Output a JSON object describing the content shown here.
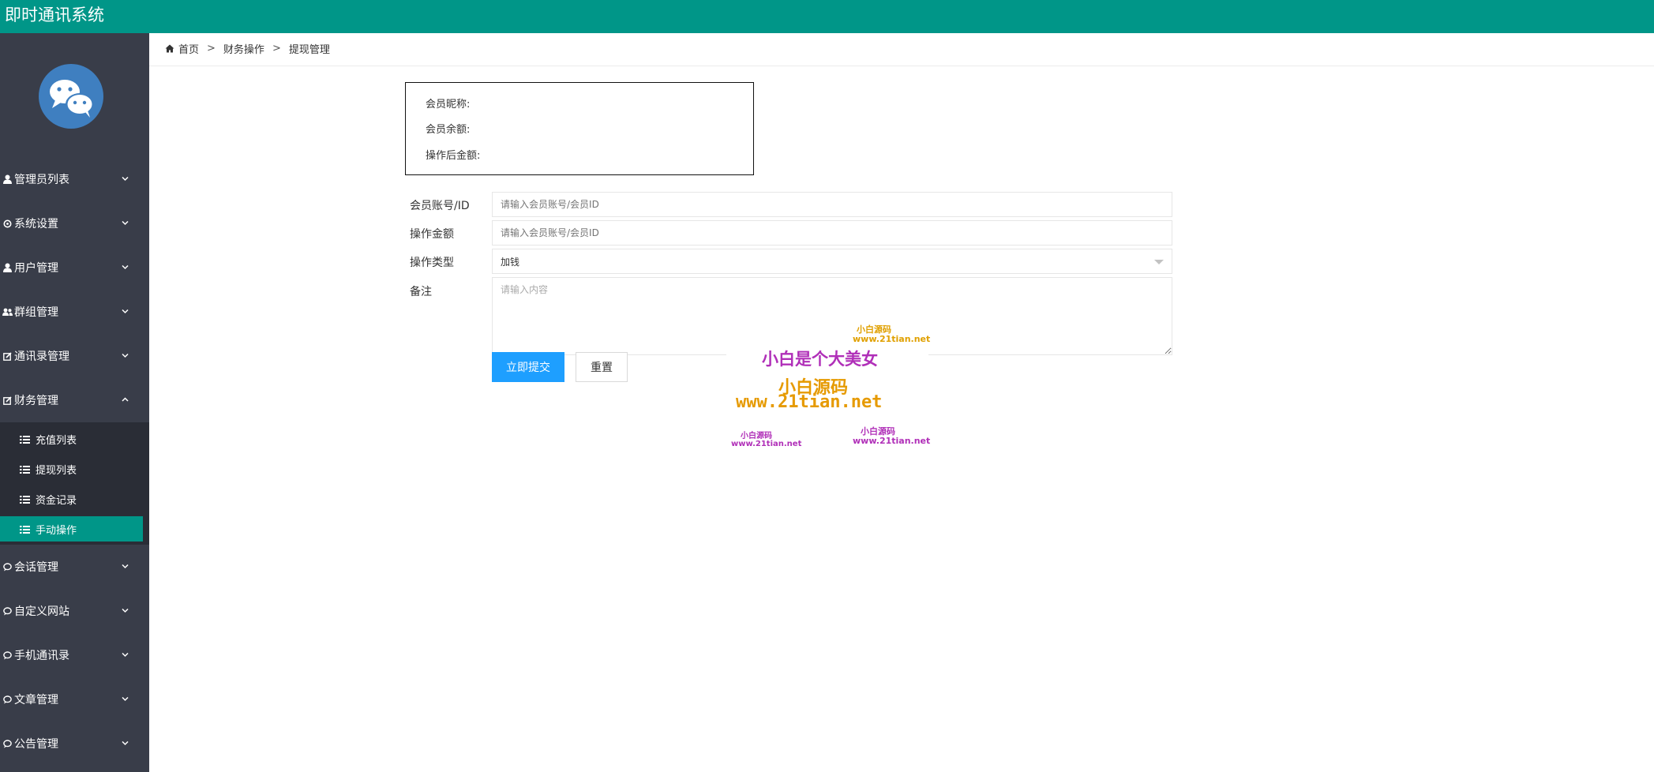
{
  "app": {
    "title": "即时通讯系统"
  },
  "colors": {
    "accent": "#009688",
    "sidebar": "#393d49",
    "submenu": "#2a2d36",
    "primary_button": "#1e9fff"
  },
  "sidebar": {
    "logo_icon": "wechat-icon",
    "menu": [
      {
        "label": "管理员列表",
        "icon": "user-icon",
        "expanded": false
      },
      {
        "label": "系统设置",
        "icon": "gear-icon",
        "expanded": false
      },
      {
        "label": "用户管理",
        "icon": "user-icon",
        "expanded": false
      },
      {
        "label": "群组管理",
        "icon": "group-icon",
        "expanded": false
      },
      {
        "label": "通讯录管理",
        "icon": "edit-icon",
        "expanded": false
      },
      {
        "label": "财务管理",
        "icon": "edit-icon",
        "expanded": true,
        "children": [
          {
            "label": "充值列表",
            "icon": "list-icon",
            "active": false
          },
          {
            "label": "提现列表",
            "icon": "list-icon",
            "active": false
          },
          {
            "label": "资金记录",
            "icon": "list-icon",
            "active": false
          },
          {
            "label": "手动操作",
            "icon": "list-icon",
            "active": true
          }
        ]
      },
      {
        "label": "会话管理",
        "icon": "chat-icon",
        "expanded": false
      },
      {
        "label": "自定义网站",
        "icon": "chat-icon",
        "expanded": false
      },
      {
        "label": "手机通讯录",
        "icon": "chat-icon",
        "expanded": false
      },
      {
        "label": "文章管理",
        "icon": "chat-icon",
        "expanded": false
      },
      {
        "label": "公告管理",
        "icon": "chat-icon",
        "expanded": false
      }
    ]
  },
  "breadcrumb": {
    "home": "首页",
    "sep": ">",
    "level1": "财务操作",
    "level2": "提现管理"
  },
  "info": {
    "nickname_label": "会员昵称:",
    "balance_label": "会员余额:",
    "after_label": "操作后金额:"
  },
  "form": {
    "account": {
      "label": "会员账号/ID",
      "placeholder": "请输入会员账号/会员ID",
      "value": ""
    },
    "amount": {
      "label": "操作金额",
      "placeholder": "请输入会员账号/会员ID",
      "value": ""
    },
    "type": {
      "label": "操作类型",
      "value": "加钱"
    },
    "remark": {
      "label": "备注",
      "placeholder": "请输入内容",
      "value": ""
    },
    "submit_label": "立即提交",
    "reset_label": "重置"
  },
  "watermark": {
    "main_text": "小白是个大美女",
    "brand_text": "小白源码",
    "url_text": "www.21tian.net"
  }
}
